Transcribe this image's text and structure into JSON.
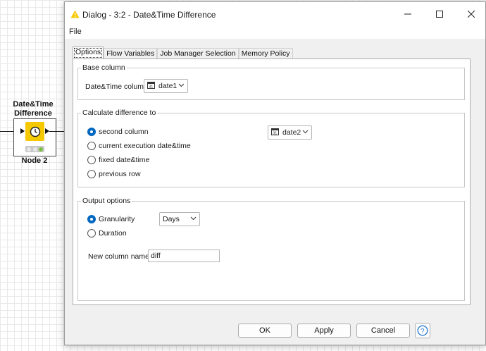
{
  "canvas": {
    "node": {
      "title_line1": "Date&Time",
      "title_line2": "Difference",
      "label": "Node 2",
      "icon": "clock-icon",
      "status": "green"
    }
  },
  "dialog": {
    "title": "Dialog - 3:2 - Date&Time Difference",
    "window_controls": [
      "minimize-icon",
      "maximize-icon",
      "close-icon"
    ],
    "menu": {
      "file": "File"
    },
    "tabs": [
      {
        "label": "Options",
        "active": true
      },
      {
        "label": "Flow Variables",
        "active": false
      },
      {
        "label": "Job Manager Selection",
        "active": false
      },
      {
        "label": "Memory Policy",
        "active": false
      }
    ],
    "base_column": {
      "legend": "Base column",
      "label": "Date&Time column",
      "value": "date1"
    },
    "calculate": {
      "legend": "Calculate difference to",
      "options": [
        {
          "label": "second column",
          "checked": true
        },
        {
          "label": "current execution date&time",
          "checked": false
        },
        {
          "label": "fixed date&time",
          "checked": false
        },
        {
          "label": "previous row",
          "checked": false
        }
      ],
      "second_column_value": "date2"
    },
    "output": {
      "legend": "Output options",
      "granularity_label": "Granularity",
      "granularity_checked": true,
      "granularity_value": "Days",
      "duration_label": "Duration",
      "duration_checked": false,
      "new_column_label": "New column name:",
      "new_column_value": "diff"
    },
    "buttons": {
      "ok": "OK",
      "apply": "Apply",
      "cancel": "Cancel"
    },
    "accent_color": "#0067c0",
    "warning_icon_color": "#f6c800"
  }
}
